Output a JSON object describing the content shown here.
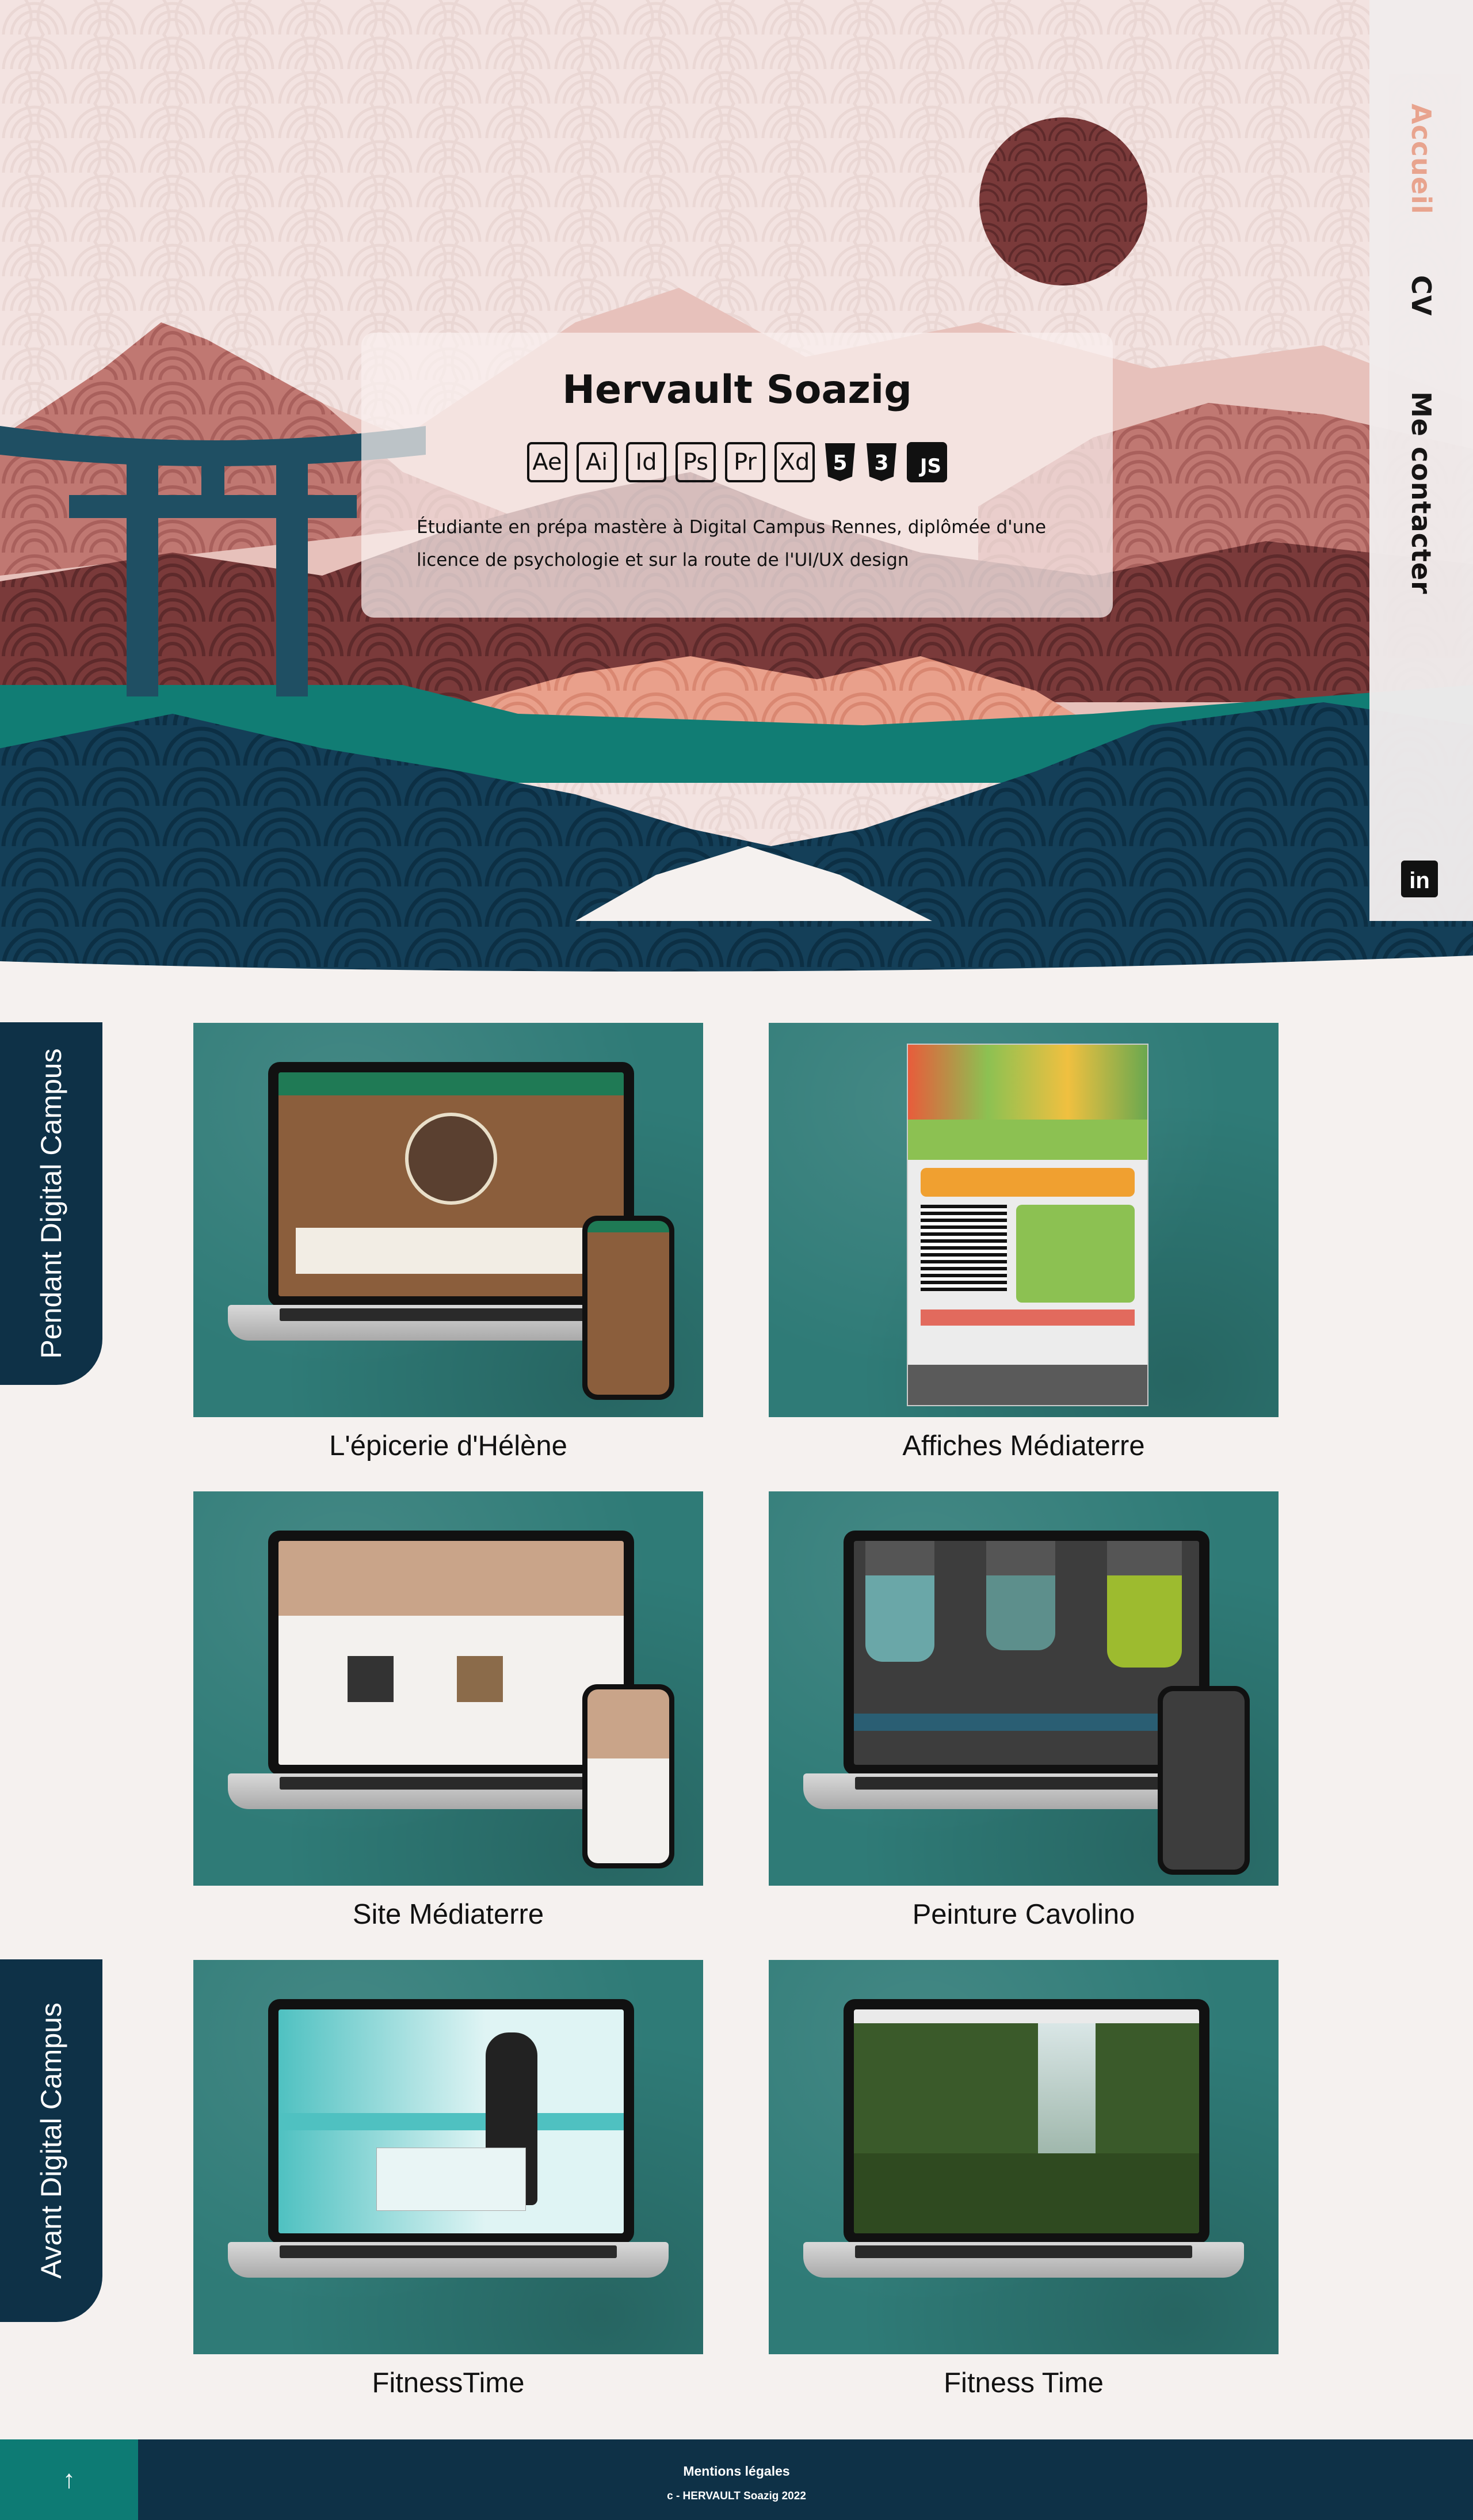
{
  "nav": {
    "items": [
      {
        "label": "Accueil",
        "active": true
      },
      {
        "label": "CV"
      },
      {
        "label": "Me contacter"
      }
    ],
    "linkedin_label": "in"
  },
  "hero": {
    "name": "Hervault Soazig",
    "skills": [
      "Ae",
      "Ai",
      "Id",
      "Ps",
      "Pr",
      "Xd",
      "5",
      "3",
      "JS"
    ],
    "description": "Étudiante en prépa mastère à Digital Campus Rennes, diplômée d'une licence de psychologie et sur la route de l'UI/UX design"
  },
  "sections": {
    "pendant": "Pendant Digital Campus",
    "avant": "Avant Digital Campus"
  },
  "projects": [
    {
      "title": "L'épicerie d'Hélène"
    },
    {
      "title": "Affiches Médiaterre"
    },
    {
      "title": "Site Médiaterre"
    },
    {
      "title": "Peinture Cavolino"
    },
    {
      "title": "FitnessTime"
    },
    {
      "title": "Fitness Time"
    }
  ],
  "footer": {
    "top_icon": "arrow-up-icon",
    "links": "Mentions légales",
    "copyright": "c - HERVAULT Soazig 2022"
  },
  "colors": {
    "accent_peach": "#e8a28c",
    "navy": "#0e3147",
    "teal": "#0d7b74",
    "wine": "#7a3a3a",
    "mockup_bg": "#2f7b77"
  }
}
